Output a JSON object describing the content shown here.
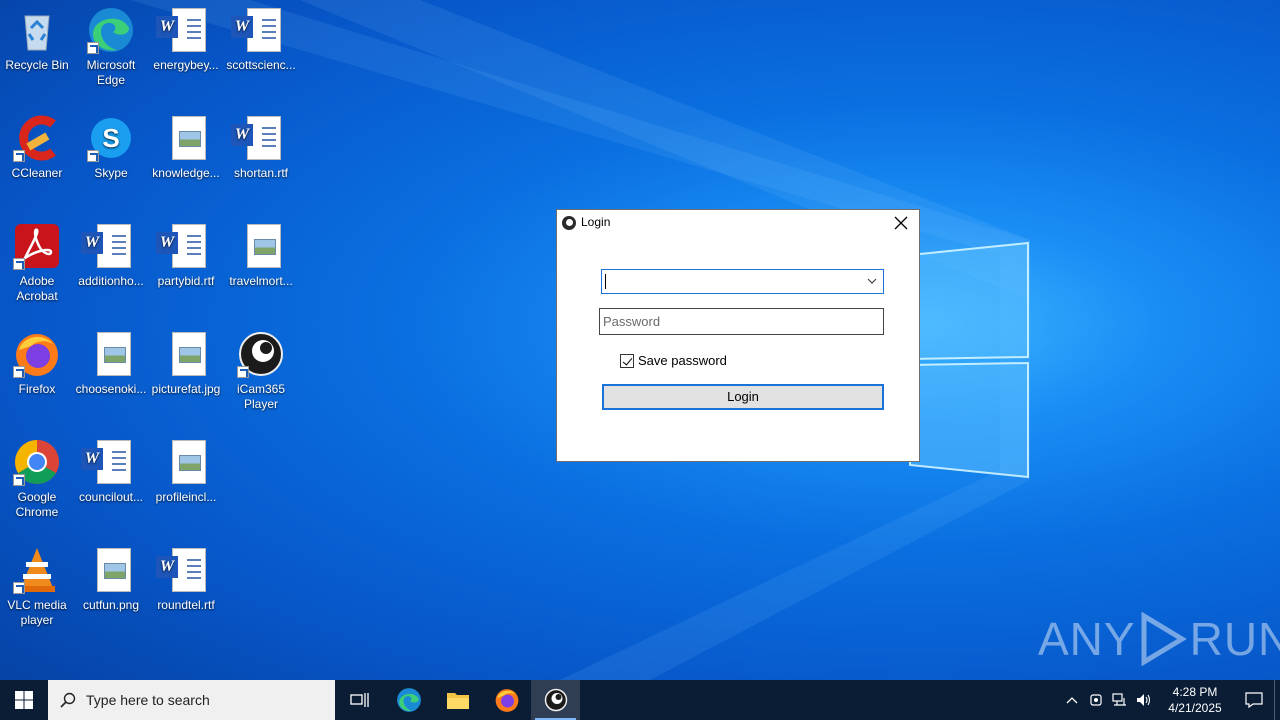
{
  "desktop": {
    "icons": [
      {
        "label": "Recycle Bin",
        "icon": "recycle-bin-icon"
      },
      {
        "label": "Microsoft Edge",
        "icon": "edge-icon"
      },
      {
        "label": "energybey...",
        "icon": "word-doc-icon"
      },
      {
        "label": "scottscienc...",
        "icon": "word-doc-icon"
      },
      {
        "label": "CCleaner",
        "icon": "ccleaner-icon"
      },
      {
        "label": "Skype",
        "icon": "skype-icon"
      },
      {
        "label": "knowledge...",
        "icon": "image-file-icon"
      },
      {
        "label": "shortan.rtf",
        "icon": "word-doc-icon"
      },
      {
        "label": "Adobe Acrobat",
        "icon": "acrobat-icon"
      },
      {
        "label": "additionho...",
        "icon": "word-doc-icon"
      },
      {
        "label": "partybid.rtf",
        "icon": "word-doc-icon"
      },
      {
        "label": "travelmort...",
        "icon": "image-file-icon"
      },
      {
        "label": "Firefox",
        "icon": "firefox-icon"
      },
      {
        "label": "choosenoki...",
        "icon": "image-file-icon"
      },
      {
        "label": "picturefat.jpg",
        "icon": "image-file-icon"
      },
      {
        "label": "iCam365 Player",
        "icon": "icam365-icon"
      },
      {
        "label": "Google Chrome",
        "icon": "chrome-icon"
      },
      {
        "label": "councilout...",
        "icon": "word-doc-icon"
      },
      {
        "label": "profileincl...",
        "icon": "image-file-icon"
      },
      {
        "label": "VLC media player",
        "icon": "vlc-icon"
      },
      {
        "label": "cutfun.png",
        "icon": "image-file-icon"
      },
      {
        "label": "roundtel.rtf",
        "icon": "word-doc-icon"
      }
    ]
  },
  "login_dialog": {
    "title": "Login",
    "username_value": "",
    "password_placeholder": "Password",
    "save_password_label": "Save password",
    "save_password_checked": true,
    "login_button_label": "Login"
  },
  "watermark": {
    "left": "ANY",
    "right": "RUN"
  },
  "taskbar": {
    "search_placeholder": "Type here to search",
    "time": "4:28 PM",
    "date": "4/21/2025"
  },
  "colors": {
    "accent": "#1a73d9",
    "taskbar": "#0b1d35"
  }
}
